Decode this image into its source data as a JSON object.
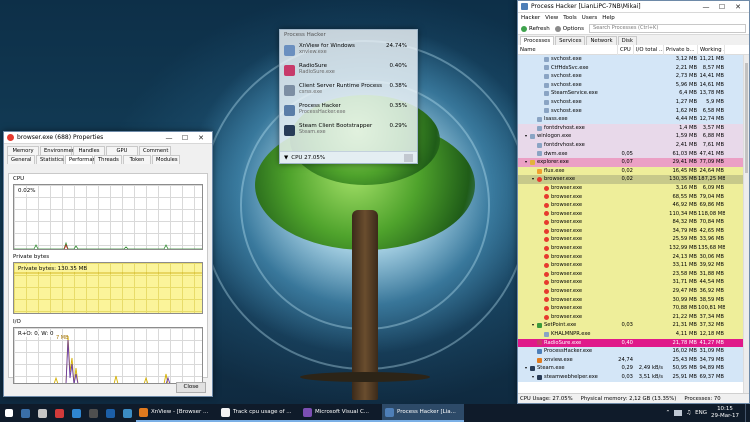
{
  "props_window": {
    "title": "browser.exe (688) Properties",
    "tabs_row1": [
      "Memory",
      "Environment",
      "Handles",
      "GPU",
      "Comment"
    ],
    "tabs_row2": [
      "General",
      "Statistics",
      "Performance",
      "Threads",
      "Token",
      "Modules"
    ],
    "active_tab": "Performance",
    "cpu_label": "CPU",
    "cpu_value": "0.02%",
    "private_bytes_label": "Private bytes",
    "private_bytes_value": "Private bytes: 130.35 MB",
    "io_label": "I/O",
    "io_value": "R+O: 0, W: 0",
    "io_peak": "7 MB",
    "close_button": "Close"
  },
  "tray_popup": {
    "header": "Process Hacker",
    "items": [
      {
        "name": "XnView for Windows",
        "exe": "xnview.exe",
        "cpu": "24.74%",
        "color": "#6a8fbf"
      },
      {
        "name": "RadioSure",
        "exe": "RadioSure.exe",
        "cpu": "0.40%",
        "color": "#c73a6a"
      },
      {
        "name": "Client Server Runtime Process",
        "exe": "csrss.exe",
        "cpu": "0.38%",
        "color": "#7c8ea3"
      },
      {
        "name": "Process Hacker",
        "exe": "ProcessHacker.exe",
        "cpu": "0.35%",
        "color": "#5a7da8"
      },
      {
        "name": "Steam Client Bootstrapper",
        "exe": "Steam.exe",
        "cpu": "0.29%",
        "color": "#283c58"
      }
    ],
    "footer": "CPU    27.05%"
  },
  "process_hacker": {
    "title": "Process Hacker [LianLiPC-7NB\\Mikai]",
    "menu": [
      "Hacker",
      "View",
      "Tools",
      "Users",
      "Help"
    ],
    "toolbar": {
      "refresh": "Refresh",
      "options": "Options",
      "search_placeholder": "Search Processes (Ctrl+K)"
    },
    "tabs": [
      "Processes",
      "Services",
      "Network",
      "Disk"
    ],
    "columns": [
      "Name",
      "CPU",
      "I/O total ...",
      "Private b...",
      "Working ..."
    ],
    "rows": [
      {
        "name": "svchost.exe",
        "cpu": "",
        "io": "",
        "pb": "3,12 MB",
        "ws": "11,21 MB",
        "indent": 3,
        "bg": "#d4e6f7",
        "tw": ""
      },
      {
        "name": "CtfHdsSvc.exe",
        "cpu": "",
        "io": "",
        "pb": "2,21 MB",
        "ws": "8,57 MB",
        "indent": 3,
        "bg": "#d4e6f7",
        "tw": ""
      },
      {
        "name": "svchost.exe",
        "cpu": "",
        "io": "",
        "pb": "2,73 MB",
        "ws": "14,41 MB",
        "indent": 3,
        "bg": "#d4e6f7",
        "tw": ""
      },
      {
        "name": "svchost.exe",
        "cpu": "",
        "io": "",
        "pb": "5,96 MB",
        "ws": "14,61 MB",
        "indent": 3,
        "bg": "#d4e6f7",
        "tw": ""
      },
      {
        "name": "SteamService.exe",
        "cpu": "",
        "io": "",
        "pb": "6,4 MB",
        "ws": "13,78 MB",
        "indent": 3,
        "bg": "#d4e6f7",
        "tw": ""
      },
      {
        "name": "svchost.exe",
        "cpu": "",
        "io": "",
        "pb": "1,27 MB",
        "ws": "5,9 MB",
        "indent": 3,
        "bg": "#d4e6f7",
        "tw": ""
      },
      {
        "name": "svchost.exe",
        "cpu": "",
        "io": "",
        "pb": "1,62 MB",
        "ws": "6,58 MB",
        "indent": 3,
        "bg": "#d4e6f7",
        "tw": ""
      },
      {
        "name": "lsass.exe",
        "cpu": "",
        "io": "",
        "pb": "4,44 MB",
        "ws": "12,74 MB",
        "indent": 2,
        "bg": "#d4e6f7",
        "tw": ""
      },
      {
        "name": "fontdrvhost.exe",
        "cpu": "",
        "io": "",
        "pb": "1,4 MB",
        "ws": "3,57 MB",
        "indent": 2,
        "bg": "#e8d9ea",
        "tw": ""
      },
      {
        "name": "winlogon.exe",
        "cpu": "",
        "io": "",
        "pb": "1,59 MB",
        "ws": "6,88 MB",
        "indent": 1,
        "bg": "#e8d9ea",
        "tw": "▾"
      },
      {
        "name": "fontdrvhost.exe",
        "cpu": "",
        "io": "",
        "pb": "2,41 MB",
        "ws": "7,61 MB",
        "indent": 2,
        "bg": "#e8d9ea",
        "tw": ""
      },
      {
        "name": "dwm.exe",
        "cpu": "0,05",
        "io": "",
        "pb": "61,03 MB",
        "ws": "47,41 MB",
        "indent": 2,
        "bg": "#e8d9ea",
        "tw": ""
      },
      {
        "name": "explorer.exe",
        "cpu": "0,07",
        "io": "",
        "pb": "29,41 MB",
        "ws": "77,09 MB",
        "indent": 1,
        "bg": "#eba0c5",
        "tw": "▾"
      },
      {
        "name": "flux.exe",
        "cpu": "0,02",
        "io": "",
        "pb": "16,45 MB",
        "ws": "24,64 MB",
        "indent": 2,
        "bg": "#eeee9a",
        "tw": ""
      },
      {
        "name": "browser.exe",
        "cpu": "0,02",
        "io": "",
        "pb": "130,35 MB",
        "ws": "187,25 MB",
        "indent": 2,
        "bg": "#c7c98a",
        "tw": "▾"
      },
      {
        "name": "browser.exe",
        "cpu": "",
        "io": "",
        "pb": "3,16 MB",
        "ws": "6,09 MB",
        "indent": 3,
        "bg": "#eeee9a",
        "tw": ""
      },
      {
        "name": "browser.exe",
        "cpu": "",
        "io": "",
        "pb": "68,55 MB",
        "ws": "79,04 MB",
        "indent": 3,
        "bg": "#eeee9a",
        "tw": ""
      },
      {
        "name": "browser.exe",
        "cpu": "",
        "io": "",
        "pb": "46,92 MB",
        "ws": "69,86 MB",
        "indent": 3,
        "bg": "#eeee9a",
        "tw": ""
      },
      {
        "name": "browser.exe",
        "cpu": "",
        "io": "",
        "pb": "110,34 MB",
        "ws": "118,08 MB",
        "indent": 3,
        "bg": "#eeee9a",
        "tw": ""
      },
      {
        "name": "browser.exe",
        "cpu": "",
        "io": "",
        "pb": "84,32 MB",
        "ws": "70,84 MB",
        "indent": 3,
        "bg": "#eeee9a",
        "tw": ""
      },
      {
        "name": "browser.exe",
        "cpu": "",
        "io": "",
        "pb": "34,79 MB",
        "ws": "42,65 MB",
        "indent": 3,
        "bg": "#eeee9a",
        "tw": ""
      },
      {
        "name": "browser.exe",
        "cpu": "",
        "io": "",
        "pb": "25,59 MB",
        "ws": "33,96 MB",
        "indent": 3,
        "bg": "#eeee9a",
        "tw": ""
      },
      {
        "name": "browser.exe",
        "cpu": "",
        "io": "",
        "pb": "132,99 MB",
        "ws": "135,68 MB",
        "indent": 3,
        "bg": "#eeee9a",
        "tw": ""
      },
      {
        "name": "browser.exe",
        "cpu": "",
        "io": "",
        "pb": "24,13 MB",
        "ws": "30,06 MB",
        "indent": 3,
        "bg": "#eeee9a",
        "tw": ""
      },
      {
        "name": "browser.exe",
        "cpu": "",
        "io": "",
        "pb": "33,11 MB",
        "ws": "39,92 MB",
        "indent": 3,
        "bg": "#eeee9a",
        "tw": ""
      },
      {
        "name": "browser.exe",
        "cpu": "",
        "io": "",
        "pb": "23,58 MB",
        "ws": "31,88 MB",
        "indent": 3,
        "bg": "#eeee9a",
        "tw": ""
      },
      {
        "name": "browser.exe",
        "cpu": "",
        "io": "",
        "pb": "31,71 MB",
        "ws": "44,54 MB",
        "indent": 3,
        "bg": "#eeee9a",
        "tw": ""
      },
      {
        "name": "browser.exe",
        "cpu": "",
        "io": "",
        "pb": "29,47 MB",
        "ws": "36,92 MB",
        "indent": 3,
        "bg": "#eeee9a",
        "tw": ""
      },
      {
        "name": "browser.exe",
        "cpu": "",
        "io": "",
        "pb": "30,99 MB",
        "ws": "38,59 MB",
        "indent": 3,
        "bg": "#eeee9a",
        "tw": ""
      },
      {
        "name": "browser.exe",
        "cpu": "",
        "io": "",
        "pb": "70,88 MB",
        "ws": "100,81 MB",
        "indent": 3,
        "bg": "#eeee9a",
        "tw": ""
      },
      {
        "name": "browser.exe",
        "cpu": "",
        "io": "",
        "pb": "21,22 MB",
        "ws": "37,34 MB",
        "indent": 3,
        "bg": "#eeee9a",
        "tw": ""
      },
      {
        "name": "SetPoint.exe",
        "cpu": "0,03",
        "io": "",
        "pb": "21,31 MB",
        "ws": "37,32 MB",
        "indent": 2,
        "bg": "#eeee9a",
        "tw": "▾"
      },
      {
        "name": "KHALMNPR.exe",
        "cpu": "",
        "io": "",
        "pb": "4,11 MB",
        "ws": "12,18 MB",
        "indent": 3,
        "bg": "#eeee9a",
        "tw": ""
      },
      {
        "name": "RadioSure.exe",
        "cpu": "0,40",
        "io": "",
        "pb": "21,78 MB",
        "ws": "41,27 MB",
        "indent": 2,
        "bg": "#e0198a",
        "tw": ""
      },
      {
        "name": "ProcessHacker.exe",
        "cpu": "",
        "io": "",
        "pb": "16,02 MB",
        "ws": "31,09 MB",
        "indent": 2,
        "bg": "#d4e6f7",
        "tw": ""
      },
      {
        "name": "xnview.exe",
        "cpu": "24,74",
        "io": "",
        "pb": "25,43 MB",
        "ws": "34,79 MB",
        "indent": 2,
        "bg": "#d4e6f7",
        "tw": ""
      },
      {
        "name": "Steam.exe",
        "cpu": "0,29",
        "io": "2,49 kB/s",
        "pb": "50,95 MB",
        "ws": "94,89 MB",
        "indent": 1,
        "bg": "#d4e6f7",
        "tw": "▾"
      },
      {
        "name": "steamwebhelper.exe",
        "cpu": "0,03",
        "io": "3,51 kB/s",
        "pb": "25,91 MB",
        "ws": "69,37 MB",
        "indent": 2,
        "bg": "#d4e6f7",
        "tw": "▾"
      }
    ],
    "status": [
      "CPU Usage: 27.05%",
      "Physical memory: 2,12 GB (13.35%)",
      "Processes: 70"
    ]
  },
  "taskbar": {
    "apps": [
      {
        "label": "XnView - [Browser ...",
        "color": "#e07a1e",
        "active": false
      },
      {
        "label": "Track cpu usage of ...",
        "color": "#f2f2f2",
        "active": false
      },
      {
        "label": "Microsoft Visual C...",
        "color": "#7b4fb3",
        "active": false
      },
      {
        "label": "Process Hacker [Lia...",
        "color": "#4e7fb8",
        "active": true
      }
    ],
    "language": "ENG",
    "time": "10:15",
    "date": "29-Mar-17"
  }
}
